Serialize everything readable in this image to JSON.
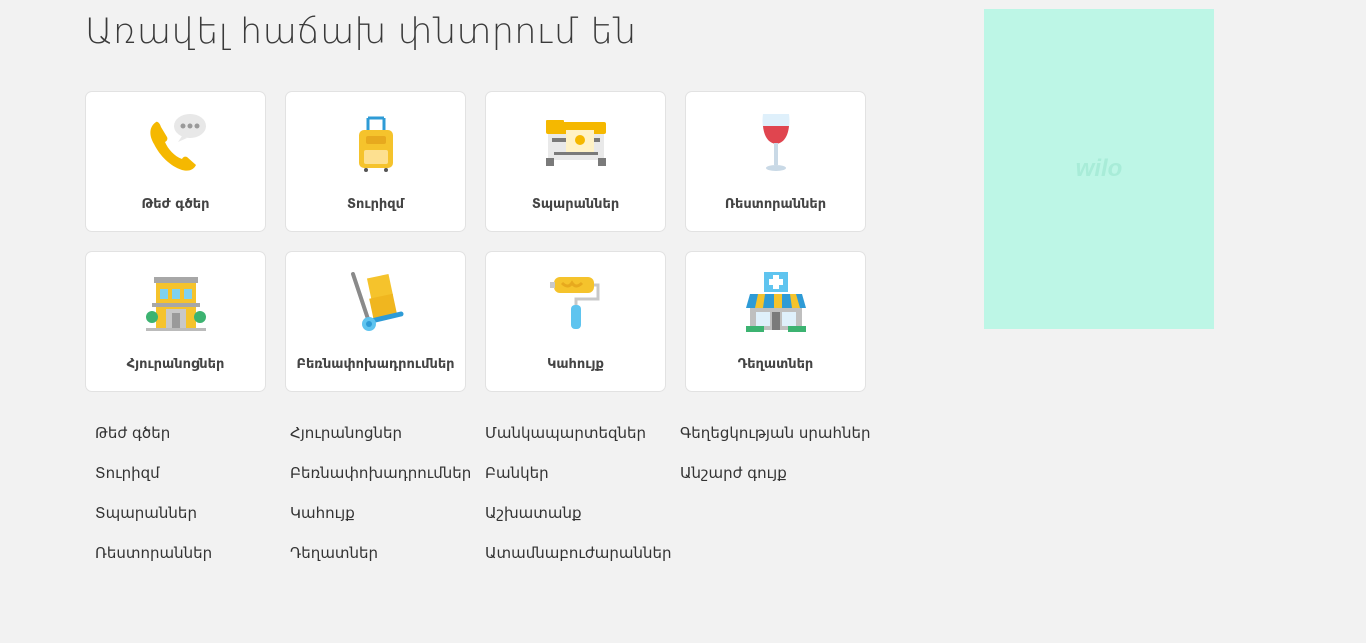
{
  "page": {
    "title": "Առավել հաճախ փնտրում են"
  },
  "categories": [
    {
      "label": "Թեժ գծեր",
      "icon": "phone-icon"
    },
    {
      "label": "Տուրիզմ",
      "icon": "suitcase-icon"
    },
    {
      "label": "Տպարաններ",
      "icon": "printer-icon"
    },
    {
      "label": "Ռեստորաններ",
      "icon": "wine-glass-icon"
    },
    {
      "label": "Հյուրանոցներ",
      "icon": "hotel-icon"
    },
    {
      "label": "Բեռնափոխադրումներ",
      "icon": "hand-truck-icon"
    },
    {
      "label": "Կահույք",
      "icon": "paint-roller-icon"
    },
    {
      "label": "Դեղատներ",
      "icon": "pharmacy-icon"
    }
  ],
  "links": [
    [
      "Թեժ գծեր",
      "Տուրիզմ",
      "Տպարաններ",
      "Ռեստորաններ"
    ],
    [
      "Հյուրանոցներ",
      "Բեռնափոխադրումներ",
      "Կահույք",
      "Դեղատներ"
    ],
    [
      "Մանկապարտեզներ",
      "Բանկեր",
      "Աշխատանք",
      "Ատամնաբուժարաններ"
    ],
    [
      "Գեղեցկության սրահներ",
      "Անշարժ գույք"
    ]
  ],
  "ad": {
    "logo": "wilo",
    "background": "#bdf6e6"
  }
}
